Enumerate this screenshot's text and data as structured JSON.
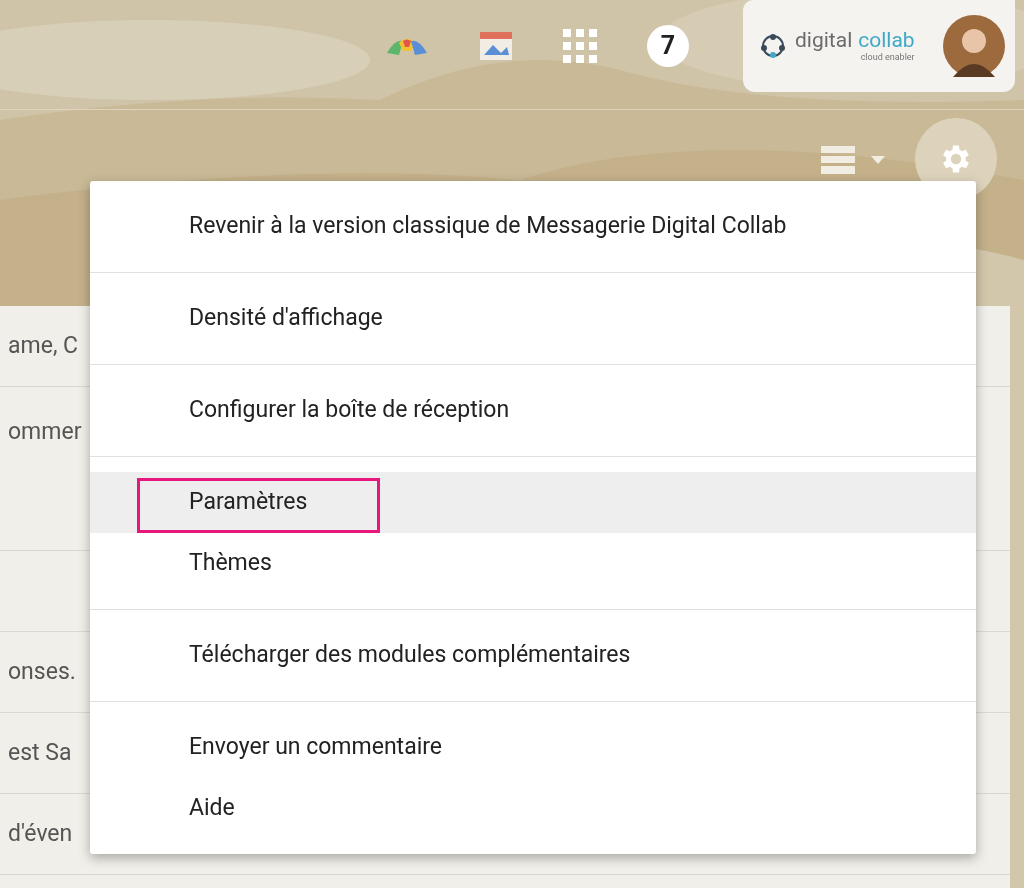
{
  "topbar": {
    "notification_count": "7",
    "account": {
      "brand": "digital",
      "brand_accent": "collab",
      "tagline": "cloud enabler"
    }
  },
  "mail_rows": [
    "ame, C",
    "ommer",
    "",
    "onses.",
    "est Sa",
    "d'éven"
  ],
  "settings_menu": {
    "sections": [
      {
        "items": [
          {
            "label": "Revenir à la version classique de Messagerie Digital Collab",
            "selected": false,
            "annotated": false
          }
        ]
      },
      {
        "items": [
          {
            "label": "Densité d'affichage",
            "selected": false,
            "annotated": false
          }
        ]
      },
      {
        "items": [
          {
            "label": "Configurer la boîte de réception",
            "selected": false,
            "annotated": false
          }
        ]
      },
      {
        "items": [
          {
            "label": "Paramètres",
            "selected": true,
            "annotated": true
          },
          {
            "label": "Thèmes",
            "selected": false,
            "annotated": false
          }
        ]
      },
      {
        "items": [
          {
            "label": "Télécharger des modules complémentaires",
            "selected": false,
            "annotated": false
          }
        ]
      },
      {
        "items": [
          {
            "label": "Envoyer un commentaire",
            "selected": false,
            "annotated": false
          },
          {
            "label": "Aide",
            "selected": false,
            "annotated": false
          }
        ]
      }
    ]
  }
}
